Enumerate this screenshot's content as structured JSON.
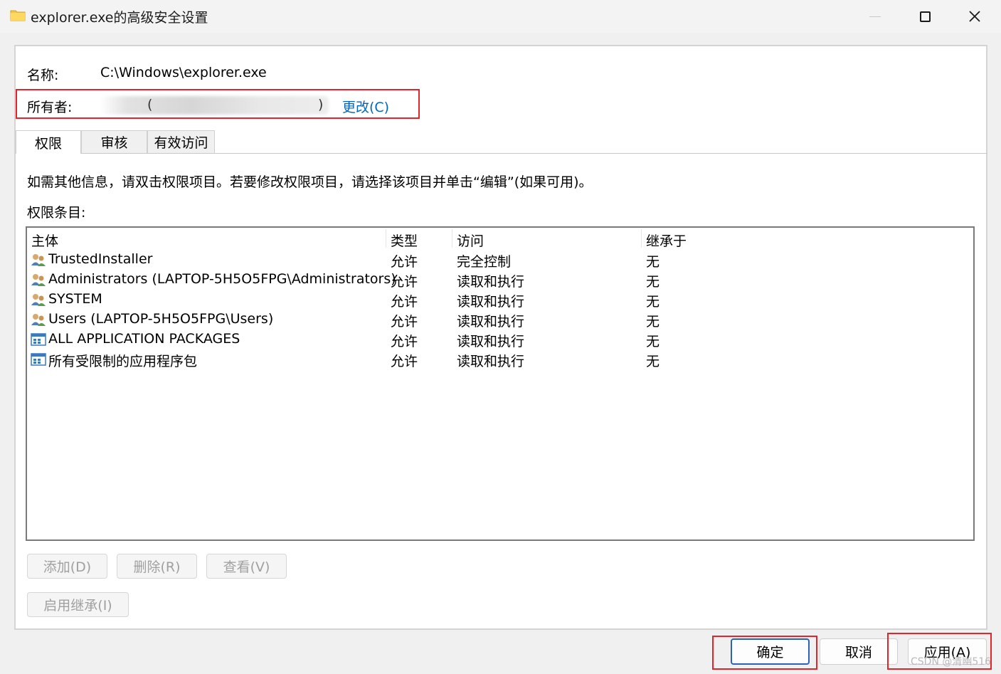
{
  "window": {
    "title": "explorer.exe的高级安全设置",
    "close_glyph": "✕"
  },
  "info": {
    "name_label": "名称:",
    "name_value": "C:\\Windows\\explorer.exe",
    "owner_label": "所有者:",
    "owner_paren_open": "(",
    "owner_paren_close": ")",
    "change_link": "更改(C)"
  },
  "tabs": [
    {
      "label": "权限",
      "active": true
    },
    {
      "label": "审核",
      "active": false
    },
    {
      "label": "有效访问",
      "active": false
    }
  ],
  "instructions": "如需其他信息，请双击权限项目。若要修改权限项目，请选择该项目并单击“编辑”(如果可用)。",
  "entries_label": "权限条目:",
  "table": {
    "columns": [
      "主体",
      "类型",
      "访问",
      "继承于"
    ],
    "rows": [
      {
        "icon": "user-group-icon",
        "principal": "TrustedInstaller",
        "type": "允许",
        "access": "完全控制",
        "inherited": "无"
      },
      {
        "icon": "user-group-icon",
        "principal": "Administrators (LAPTOP-5H5O5FPG\\Administrators)",
        "type": "允许",
        "access": "读取和执行",
        "inherited": "无"
      },
      {
        "icon": "user-group-icon",
        "principal": "SYSTEM",
        "type": "允许",
        "access": "读取和执行",
        "inherited": "无"
      },
      {
        "icon": "user-group-icon",
        "principal": "Users (LAPTOP-5H5O5FPG\\Users)",
        "type": "允许",
        "access": "读取和执行",
        "inherited": "无"
      },
      {
        "icon": "app-package-icon",
        "principal": "ALL APPLICATION PACKAGES",
        "type": "允许",
        "access": "读取和执行",
        "inherited": "无"
      },
      {
        "icon": "app-package-icon",
        "principal": "所有受限制的应用程序包",
        "type": "允许",
        "access": "读取和执行",
        "inherited": "无"
      }
    ]
  },
  "buttons": {
    "add": "添加(D)",
    "remove": "删除(R)",
    "view": "查看(V)",
    "enable_inheritance": "启用继承(I)",
    "ok": "确定",
    "cancel": "取消",
    "apply": "应用(A)"
  },
  "watermark": "CSDN @清幽516",
  "colors": {
    "link": "#0067c0",
    "highlight_box": "#e3242b",
    "default_button_border": "#2a63b8"
  }
}
